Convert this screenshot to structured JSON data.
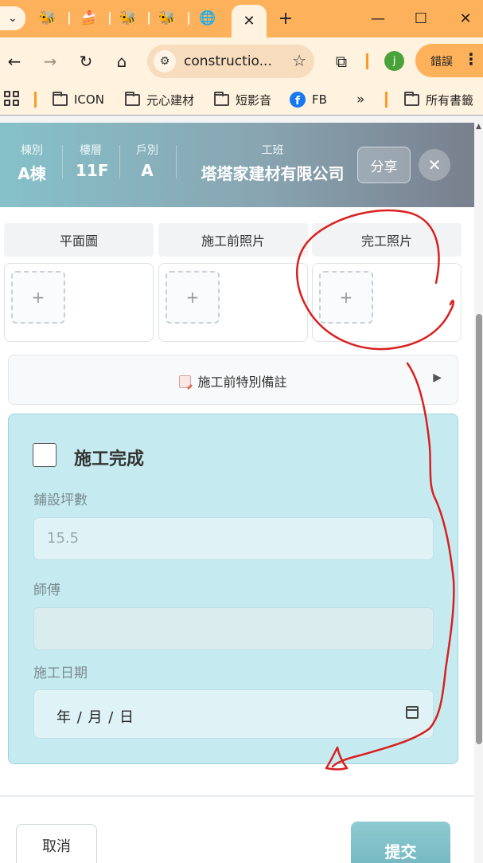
{
  "browser": {
    "tabs": [
      {
        "icon": "bee-icon",
        "glyph": "🐝"
      },
      {
        "icon": "cake-icon",
        "glyph": "🍰"
      },
      {
        "icon": "bee-icon",
        "glyph": "🐝"
      },
      {
        "icon": "bee-icon",
        "glyph": "🐝"
      },
      {
        "icon": "globe-icon",
        "glyph": "🌐"
      }
    ],
    "active_tab_close": "✕",
    "new_tab": "+",
    "url": "constructio...",
    "profile_initial": "j",
    "error_label": "錯誤",
    "bookmarks": [
      {
        "label": "ICON"
      },
      {
        "label": "元心建材"
      },
      {
        "label": "短影音"
      },
      {
        "label": "FB"
      },
      {
        "label": "所有書籤"
      }
    ],
    "more": "»"
  },
  "header": {
    "building_label": "棟別",
    "building_value": "A棟",
    "floor_label": "樓層",
    "floor_value": "11F",
    "unit_label": "戶別",
    "unit_value": "A",
    "crew_label": "工班",
    "crew_value": "塔塔家建材有限公司",
    "share_label": "分享",
    "close_label": "✕"
  },
  "photo_tabs": [
    {
      "label": "平面圖"
    },
    {
      "label": "施工前照片"
    },
    {
      "label": "完工照片"
    }
  ],
  "add_symbol": "+",
  "note": {
    "label": "施工前特別備註",
    "arrow": "▶"
  },
  "completion": {
    "title": "施工完成",
    "checked": false,
    "area_label": "鋪設坪數",
    "area_value": "15.5",
    "worker_label": "師傅",
    "worker_value": "",
    "date_label": "施工日期",
    "date_value": "年 / 月 / 日"
  },
  "footer": {
    "cancel_label": "取消",
    "submit_label": "提交"
  },
  "colors": {
    "tab_bar": "#fdb15a",
    "toolbar": "#fff2de",
    "header_start": "#86c1ca",
    "header_end": "#797f8d",
    "panel": "#c5ebf0",
    "submit": "#7fc0c8",
    "annotation": "#d9201f"
  }
}
